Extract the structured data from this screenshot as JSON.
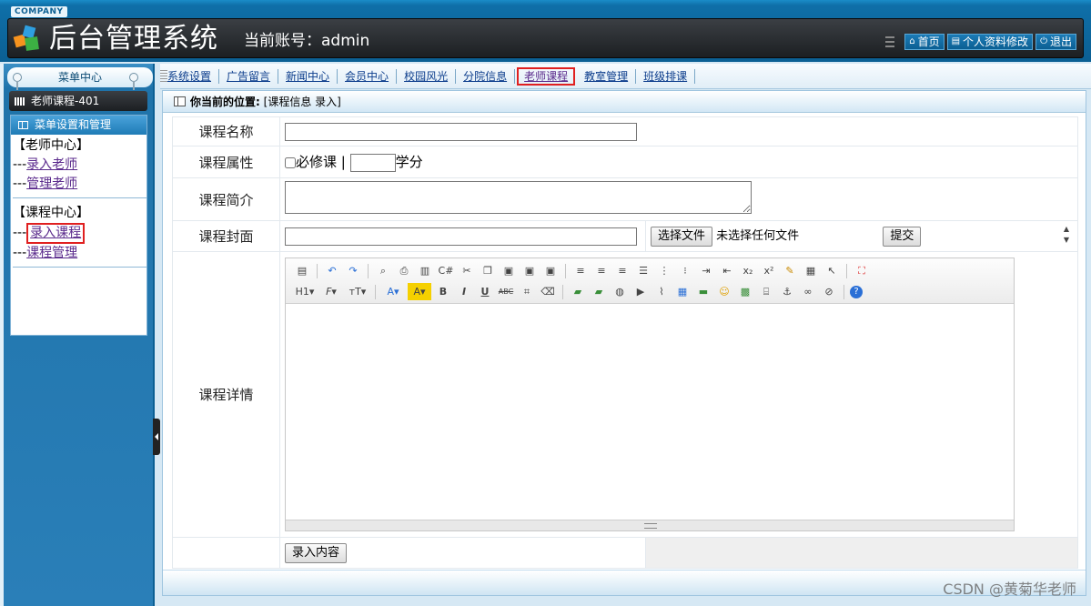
{
  "header": {
    "company": "COMPANY",
    "title": "后台管理系统",
    "account_label": "当前账号：admin",
    "buttons": {
      "home": "首页",
      "profile": "个人资料修改",
      "logout": "退出"
    }
  },
  "sidebar": {
    "menu_center": "菜单中心",
    "current_course": "老师课程-401",
    "box_title": "菜单设置和管理",
    "groups": [
      {
        "title": "【老师中心】",
        "items": [
          {
            "prefix": "---",
            "label": "录入老师"
          },
          {
            "prefix": "---",
            "label": "管理老师"
          }
        ]
      },
      {
        "title": "【课程中心】",
        "items": [
          {
            "prefix": "---",
            "label": "录入课程"
          },
          {
            "prefix": "---",
            "label": "课程管理"
          }
        ]
      }
    ]
  },
  "nav": {
    "tabs": [
      "系统设置",
      "广告留言",
      "新闻中心",
      "会员中心",
      "校园风光",
      "分院信息",
      "老师课程",
      "教室管理",
      "班级排课"
    ],
    "active_index": 6
  },
  "breadcrumb": {
    "label": "你当前的位置:",
    "value": "[课程信息 录入]"
  },
  "form": {
    "name_label": "课程名称",
    "name_value": "",
    "attr_label": "课程属性",
    "required_label": "必修课",
    "required_checked": false,
    "divider": "|",
    "credit_value": "",
    "credit_unit": "学分",
    "intro_label": "课程简介",
    "intro_value": "",
    "cover_label": "课程封面",
    "cover_value": "",
    "choose_file": "选择文件",
    "no_file": "未选择任何文件",
    "submit": "提交",
    "detail_label": "课程详情",
    "save_button": "录入内容"
  },
  "editor": {
    "toolbar_row1": [
      "source",
      "undo",
      "redo",
      "preview",
      "print",
      "template",
      "code",
      "cut",
      "copy",
      "paste",
      "paste-text",
      "paste-word",
      "justify-left",
      "justify-center",
      "justify-right",
      "justify-full",
      "ordered-list",
      "unordered-list",
      "indent",
      "outdent",
      "subscript",
      "superscript",
      "clear-format",
      "select-all",
      "pointer",
      "fullscreen"
    ],
    "heading": "H1",
    "font": "F",
    "size": "тT"
  },
  "watermark": "CSDN @黄菊华老师",
  "colors": {
    "header": "#0b5f93",
    "highlight": "#e02020",
    "link": "#0c3d8c"
  }
}
